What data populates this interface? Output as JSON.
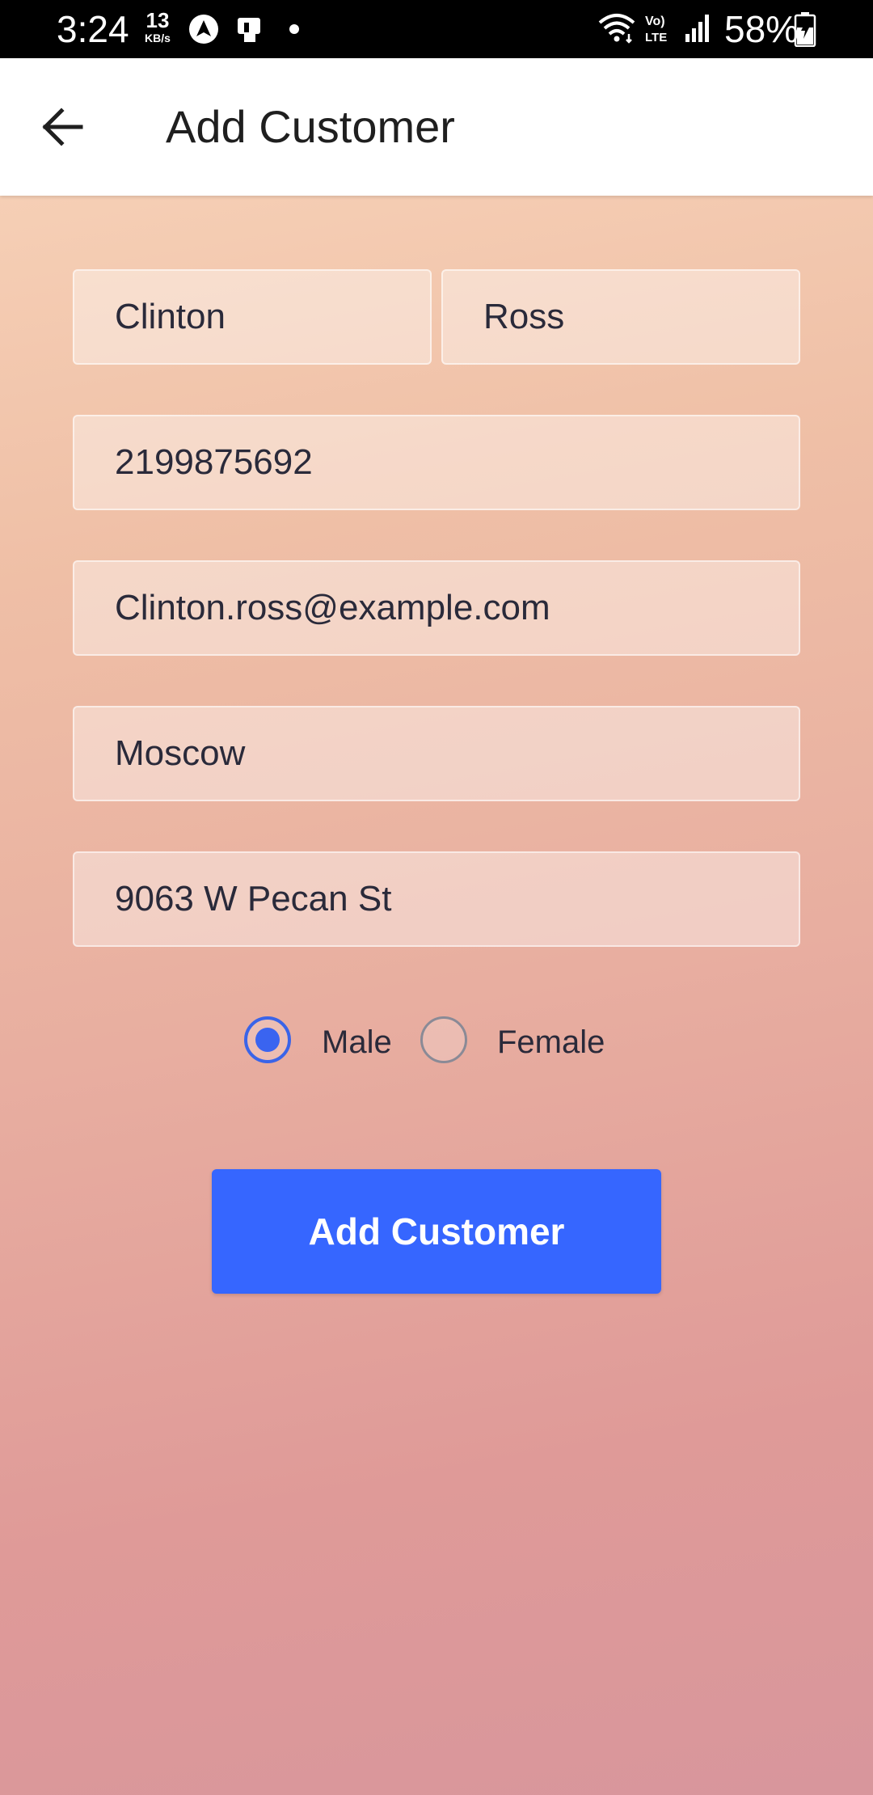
{
  "status_bar": {
    "time": "3:24",
    "network_speed": "13",
    "network_speed_unit": "KB/s",
    "battery_percent": "58%"
  },
  "app_bar": {
    "title": "Add Customer",
    "back_icon": "arrow-left-icon"
  },
  "form": {
    "first_name": "Clinton",
    "last_name": "Ross",
    "phone": "2199875692",
    "email": "Clinton.ross@example.com",
    "city": "Moscow",
    "address": "9063 W Pecan St",
    "gender": {
      "options": [
        "Male",
        "Female"
      ],
      "selected": "Male"
    },
    "submit_label": "Add Customer"
  },
  "colors": {
    "accent": "#3666ff",
    "radio_selected": "#3a64f0"
  }
}
